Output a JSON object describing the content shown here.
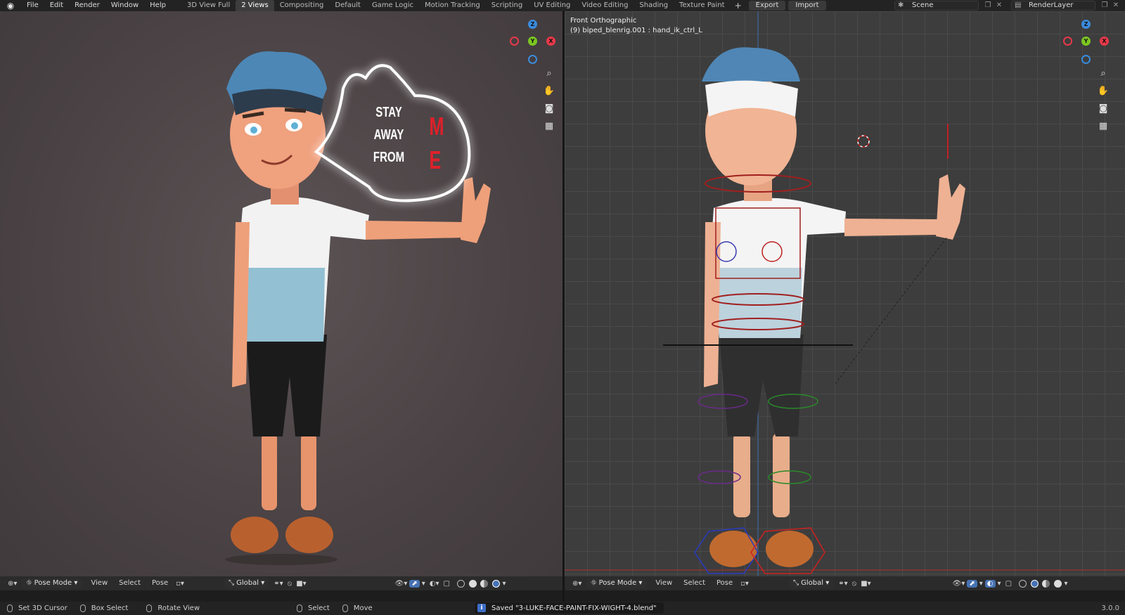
{
  "menu": [
    "File",
    "Edit",
    "Render",
    "Window",
    "Help"
  ],
  "workspaces": [
    "3D View Full",
    "2 Views",
    "Compositing",
    "Default",
    "Game Logic",
    "Motion Tracking",
    "Scripting",
    "UV Editing",
    "Video Editing",
    "Shading",
    "Texture Paint"
  ],
  "active_workspace": "2 Views",
  "buttons": {
    "export": "Export",
    "import": "Import"
  },
  "scene": "Scene",
  "render_layer": "RenderLayer",
  "left_viewport": {
    "speech_bubble": {
      "line1": "STAY AWAY",
      "line2": "FROM",
      "letter1": "M",
      "letter2": "E"
    }
  },
  "right_viewport": {
    "view_name": "Front Orthographic",
    "active_object": "(9) biped_blenrig.001 : hand_ik_ctrl_L"
  },
  "gizmo_labels": {
    "z": "Z",
    "y": "Y",
    "x": "X"
  },
  "header_left": {
    "mode": "Pose Mode",
    "menus": [
      "View",
      "Select",
      "Pose"
    ],
    "transform": "Global"
  },
  "header_right": {
    "mode": "Pose Mode",
    "menus": [
      "View",
      "Select",
      "Pose"
    ],
    "transform": "Global"
  },
  "status": {
    "set_cursor": "Set 3D Cursor",
    "box_select": "Box Select",
    "rotate_view": "Rotate View",
    "select": "Select",
    "move": "Move",
    "saved_message": "Saved \"3-LUKE-FACE-PAINT-FIX-WIGHT-4.blend\"",
    "version": "3.0.0"
  },
  "colors": {
    "accent": "#4772b3",
    "x_axis": "#e8394a",
    "y_axis": "#7cc622",
    "z_axis": "#3a8bdc"
  }
}
